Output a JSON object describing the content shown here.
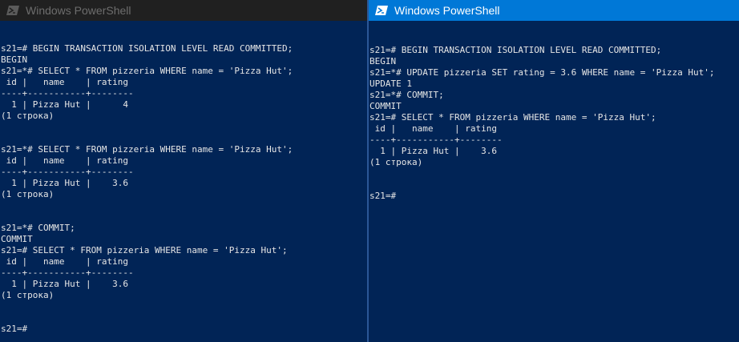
{
  "colors": {
    "console_bg": "#012456",
    "console_text": "#e6e6e6",
    "active_titlebar": "#0078d7",
    "inactive_titlebar": "#202020"
  },
  "left_window": {
    "title": "Windows PowerShell",
    "icon": "powershell-icon",
    "lines": [
      "s21=# BEGIN TRANSACTION ISOLATION LEVEL READ COMMITTED;",
      "BEGIN",
      "s21=*# SELECT * FROM pizzeria WHERE name = 'Pizza Hut';",
      " id |   name    | rating",
      "----+-----------+--------",
      "  1 | Pizza Hut |      4",
      "(1 строка)",
      "",
      "",
      "s21=*# SELECT * FROM pizzeria WHERE name = 'Pizza Hut';",
      " id |   name    | rating",
      "----+-----------+--------",
      "  1 | Pizza Hut |    3.6",
      "(1 строка)",
      "",
      "",
      "s21=*# COMMIT;",
      "COMMIT",
      "s21=# SELECT * FROM pizzeria WHERE name = 'Pizza Hut';",
      " id |   name    | rating",
      "----+-----------+--------",
      "  1 | Pizza Hut |    3.6",
      "(1 строка)",
      "",
      "",
      "s21=#"
    ]
  },
  "right_window": {
    "title": "Windows PowerShell",
    "icon": "powershell-icon",
    "lines": [
      "s21=# BEGIN TRANSACTION ISOLATION LEVEL READ COMMITTED;",
      "BEGIN",
      "s21=*# UPDATE pizzeria SET rating = 3.6 WHERE name = 'Pizza Hut';",
      "UPDATE 1",
      "s21=*# COMMIT;",
      "COMMIT",
      "s21=# SELECT * FROM pizzeria WHERE name = 'Pizza Hut';",
      " id |   name    | rating",
      "----+-----------+--------",
      "  1 | Pizza Hut |    3.6",
      "(1 строка)",
      "",
      "",
      "s21=#"
    ]
  }
}
